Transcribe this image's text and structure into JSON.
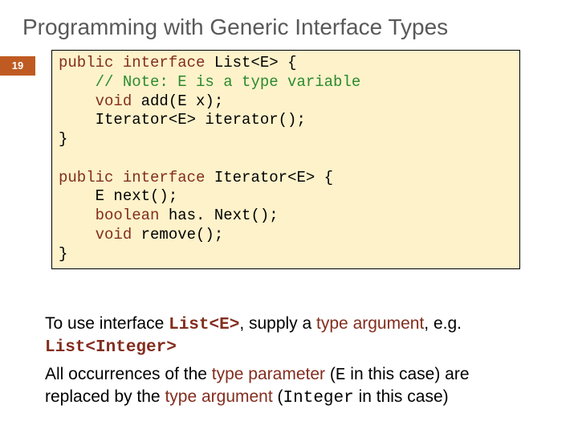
{
  "slide": {
    "title": "Programming with Generic Interface Types",
    "page_number": "19"
  },
  "code": {
    "l1a": "public",
    "l1b": " ",
    "l1c": "interface",
    "l1d": " List<E> {",
    "l2": "    // Note: E is a type variable",
    "l3a": "    ",
    "l3b": "void",
    "l3c": " add(E x);",
    "l4": "    Iterator<E> iterator();",
    "l5": "}",
    "blank": " ",
    "l6a": "public",
    "l6b": " ",
    "l6c": "interface",
    "l6d": " Iterator<E> {",
    "l7": "    E next();",
    "l8a": "    ",
    "l8b": "boolean",
    "l8c": " has. Next();",
    "l9a": "    ",
    "l9b": "void",
    "l9c": " remove();",
    "l10": "}"
  },
  "body": {
    "p1_a": "To use interface ",
    "p1_code1": "List<E>",
    "p1_b": ", supply a ",
    "p1_term": "type argument",
    "p1_c": ", e.g. ",
    "p1_code2": "List<Integer>",
    "p2_a": "All occurrences of the ",
    "p2_term1": "type parameter",
    "p2_b": " (",
    "p2_code1": "E",
    "p2_c": " in this case) are replaced by the ",
    "p2_term2": "type argument",
    "p2_d": " (",
    "p2_code2": "Integer",
    "p2_e": " in this case)"
  }
}
